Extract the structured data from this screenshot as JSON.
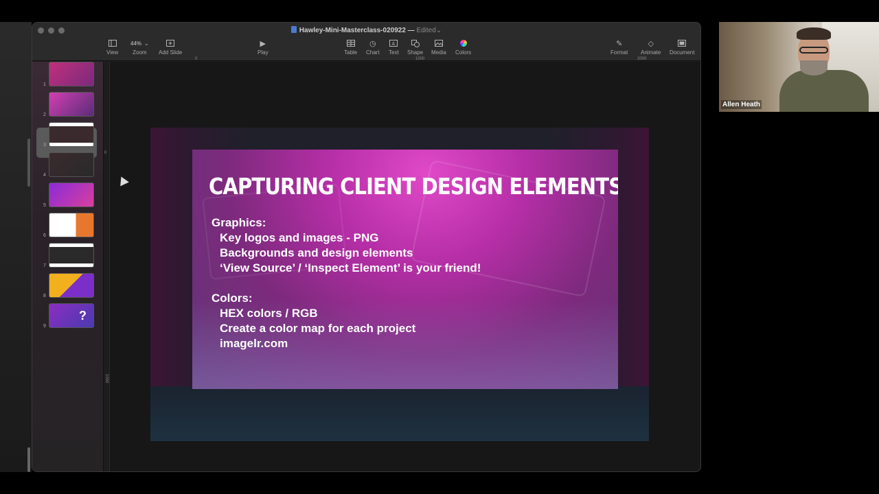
{
  "window": {
    "title": "Hawley-Mini-Masterclass-020922",
    "title_separator": "—",
    "status": "Edited"
  },
  "toolbar": {
    "view": "View",
    "zoom": "Zoom",
    "zoom_value": "44%",
    "add_slide": "Add Slide",
    "play": "Play",
    "table": "Table",
    "chart": "Chart",
    "text": "Text",
    "shape": "Shape",
    "media": "Media",
    "colors": "Colors",
    "format": "Format",
    "animate": "Animate",
    "document": "Document"
  },
  "ruler": {
    "marks": [
      "0",
      "1000",
      "2000"
    ]
  },
  "vertical_ruler": {
    "marks": [
      "0",
      "1000"
    ]
  },
  "slides": [
    {
      "number": "1",
      "colors": [
        "#c0307a",
        "#7b2a7e"
      ]
    },
    {
      "number": "2",
      "colors": [
        "#d23fb2",
        "#5a2d78"
      ]
    },
    {
      "number": "3",
      "colors": [
        "#ffffff",
        "#3a2a2e"
      ]
    },
    {
      "number": "4",
      "colors": [
        "#3a2a2e",
        "#2a2a2a"
      ]
    },
    {
      "number": "5",
      "colors": [
        "#8a2bd8",
        "#d93f9e"
      ]
    },
    {
      "number": "6",
      "colors": [
        "#ffffff",
        "#e8772e"
      ]
    },
    {
      "number": "7",
      "colors": [
        "#ffffff",
        "#2a2a2a"
      ]
    },
    {
      "number": "8",
      "colors": [
        "#f2b01e",
        "#7b2fc8"
      ]
    },
    {
      "number": "9",
      "colors": [
        "#8b2ec0",
        "#4a3ab0"
      ]
    }
  ],
  "active_slide": {
    "title": "CAPTURING CLIENT DESIGN ELEMENTS",
    "graphics_heading": "Graphics:",
    "graphics_items": [
      "Key logos and images - PNG",
      "Backgrounds and design elements",
      "‘View Source’ / ‘Inspect Element’ is your friend!"
    ],
    "colors_heading": "Colors:",
    "colors_items": [
      "HEX colors / RGB",
      "Create a color map for each project",
      "imagelr.com"
    ]
  },
  "video": {
    "participant_name": "Allen Heath"
  }
}
